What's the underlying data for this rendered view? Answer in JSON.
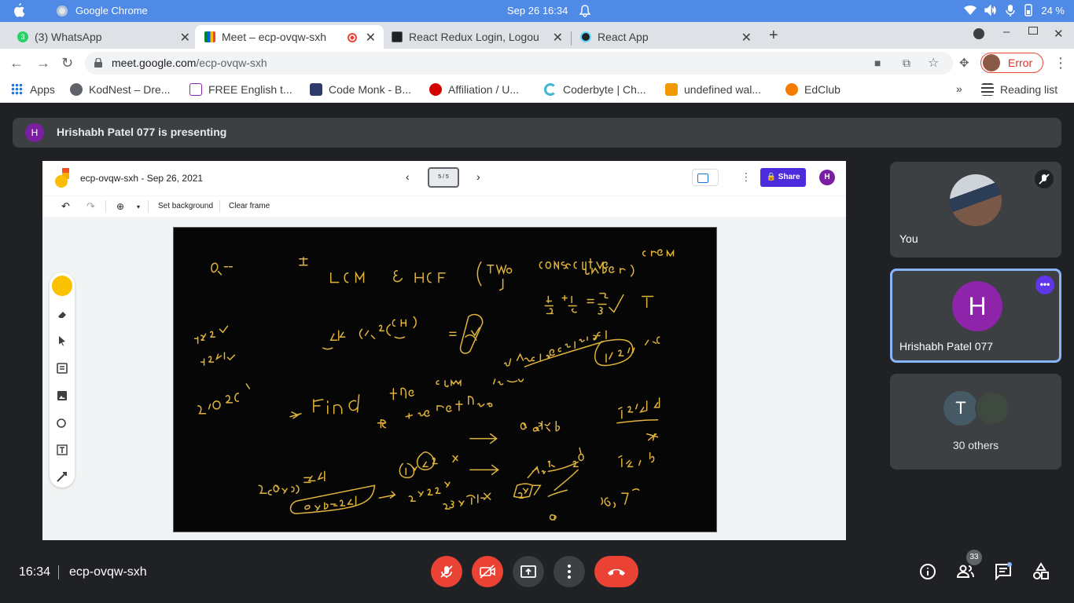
{
  "system": {
    "app_name": "Google Chrome",
    "datetime": "Sep 26  16:34",
    "battery": "24 %"
  },
  "tabs": [
    {
      "label": "(3) WhatsApp",
      "badge": "3"
    },
    {
      "label": "Meet – ecp-ovqw-sxh"
    },
    {
      "label": "React Redux Login, Logou"
    },
    {
      "label": "React App"
    }
  ],
  "address": {
    "host": "meet.google.com",
    "path": "/ecp-ovqw-sxh",
    "profile_status": "Error"
  },
  "bookmarks": [
    {
      "label": "Apps"
    },
    {
      "label": "KodNest – Dre..."
    },
    {
      "label": "FREE English t..."
    },
    {
      "label": "Code Monk - B..."
    },
    {
      "label": "Affiliation / U..."
    },
    {
      "label": "Coderbyte | Ch..."
    },
    {
      "label": "undefined wal..."
    },
    {
      "label": "EdClub"
    }
  ],
  "bookmarks_overflow": "»",
  "reading_list": "Reading list",
  "meet": {
    "presenting_initial": "H",
    "presenting_text": "Hrishabh Patel 077 is presenting",
    "jamboard": {
      "title": "ecp-ovqw-sxh - Sep 26, 2021",
      "frame_indicator": "5 / 5",
      "share_label": "Share",
      "avatar_initial": "H",
      "set_background": "Set background",
      "clear_frame": "Clear frame"
    },
    "participants": {
      "you_label": "You",
      "host_initial": "H",
      "host_name": "Hrishabh Patel 077",
      "others_initial": "T",
      "others_label": "30 others"
    },
    "bottom": {
      "time": "16:34",
      "meeting_code": "ecp-ovqw-sxh",
      "people_count": "33"
    }
  },
  "colors": {
    "accent_red": "#ea4335",
    "host_purple": "#8e24aa",
    "jam_share": "#4b2bdb",
    "highlight_border": "#8ab4f8"
  }
}
